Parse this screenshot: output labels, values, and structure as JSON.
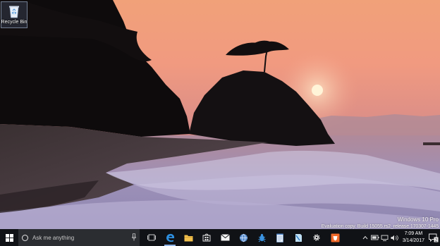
{
  "desktop": {
    "icons": [
      {
        "label": "Recycle Bin",
        "icon": "recycle-bin-icon"
      }
    ],
    "watermark": {
      "edition": "Windows 10 Pro",
      "build": "Evaluation copy. Build 15055.rs2_release.170307-1445"
    }
  },
  "taskbar": {
    "start_icon": "windows-logo-icon",
    "search": {
      "placeholder": "Ask me anything",
      "icon": "cortana-icon",
      "mic_icon": "microphone-icon"
    },
    "apps": [
      {
        "icon": "task-view-icon"
      },
      {
        "icon": "edge-icon"
      },
      {
        "icon": "file-explorer-icon"
      },
      {
        "icon": "store-icon"
      },
      {
        "icon": "mail-icon"
      },
      {
        "icon": "network-globe-icon"
      },
      {
        "icon": "bug-icon"
      },
      {
        "icon": "notepad-icon"
      },
      {
        "icon": "notes-icon"
      },
      {
        "icon": "settings-gear-icon"
      },
      {
        "icon": "orange-app-icon"
      }
    ],
    "tray": {
      "icons": [
        "chevron-up-icon",
        "battery-icon",
        "network-icon",
        "volume-icon"
      ],
      "time": "7:09 AM",
      "date": "3/14/2017",
      "notification_count": "2"
    }
  },
  "colors": {
    "taskbar": "#101216",
    "search_box": "#2b2d31",
    "sky_top": "#f1a179",
    "sun": "#fff4d8"
  }
}
